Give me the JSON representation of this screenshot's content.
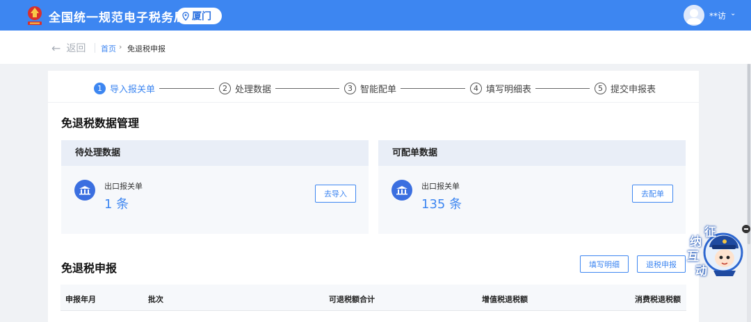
{
  "header": {
    "title": "全国统一规范电子税务局",
    "region": "厦门",
    "user_name": "**访",
    "emblem_icon": "tax-emblem-icon",
    "location_icon": "map-pin-icon",
    "caret_icon": "chevron-down-icon"
  },
  "breadcrumb": {
    "back_label": "返回",
    "home": "首页",
    "separator": "›",
    "current": "免退税申报"
  },
  "stepper": {
    "steps": [
      {
        "num": "1",
        "label": "导入报关单",
        "active": true
      },
      {
        "num": "2",
        "label": "处理数据",
        "active": false
      },
      {
        "num": "3",
        "label": "智能配单",
        "active": false
      },
      {
        "num": "4",
        "label": "填写明细表",
        "active": false
      },
      {
        "num": "5",
        "label": "提交申报表",
        "active": false
      }
    ]
  },
  "data_management": {
    "title": "免退税数据管理",
    "pending": {
      "title": "待处理数据",
      "item_label": "出口报关单",
      "count": "1 条",
      "button": "去导入"
    },
    "matchable": {
      "title": "可配单数据",
      "item_label": "出口报关单",
      "count": "135 条",
      "button": "去配单"
    }
  },
  "declaration": {
    "title": "免退税申报",
    "fill_detail_button": "填写明细",
    "refund_button": "退税申报",
    "columns": [
      "申报年月",
      "批次",
      "可退税额合计",
      "增值税退税额",
      "消费税退税额"
    ]
  },
  "mascot": {
    "chars": [
      "征",
      "纳",
      "互",
      "动"
    ]
  },
  "colors": {
    "brand": "#3d86f1",
    "header_bg": "#3d86f1",
    "icon_bg": "#3b6fe0"
  }
}
